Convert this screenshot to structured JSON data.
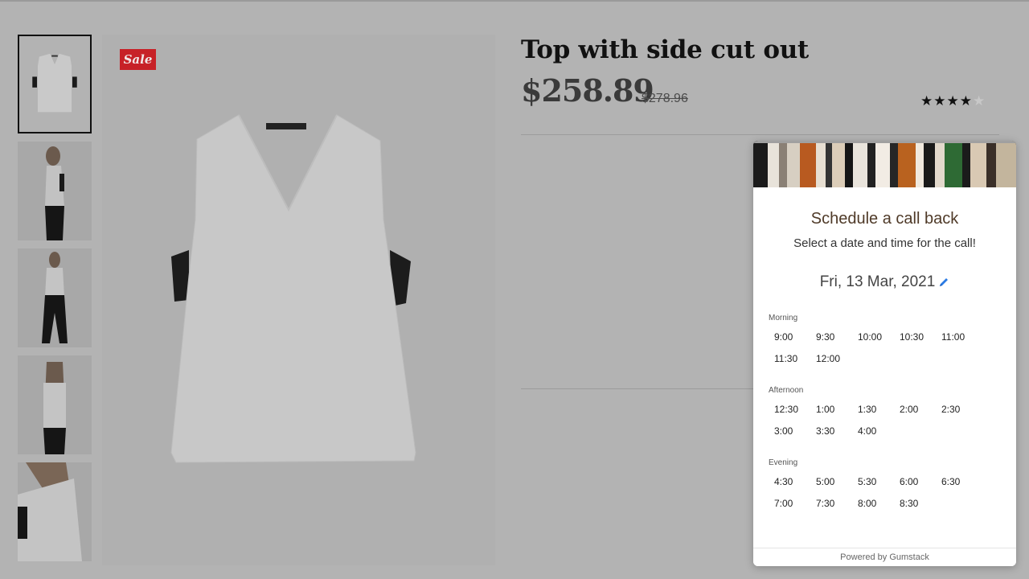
{
  "product": {
    "title": "Top with side cut out",
    "price": "$258.89",
    "old_price": "$278.96",
    "sale_label": "Sale",
    "rating": 4,
    "rating_max": 5
  },
  "thumbnails": [
    {
      "name": "thumbnail-garment-front",
      "selected": true
    },
    {
      "name": "thumbnail-model-side"
    },
    {
      "name": "thumbnail-model-front"
    },
    {
      "name": "thumbnail-model-back"
    },
    {
      "name": "thumbnail-model-closeup"
    }
  ],
  "widget": {
    "title": "Schedule a call back",
    "subtitle": "Select a date and time for the call!",
    "date": "Fri, 13 Mar, 2021",
    "groups": [
      {
        "label": "Morning",
        "slots": [
          "9:00",
          "9:30",
          "10:00",
          "10:30",
          "11:00",
          "11:30",
          "12:00"
        ]
      },
      {
        "label": "Afternoon",
        "slots": [
          "12:30",
          "1:00",
          "1:30",
          "2:00",
          "2:30",
          "3:00",
          "3:30",
          "4:00"
        ]
      },
      {
        "label": "Evening",
        "slots": [
          "4:30",
          "5:00",
          "5:30",
          "6:00",
          "6:30",
          "7:00",
          "7:30",
          "8:00",
          "8:30"
        ]
      }
    ],
    "footer": "Powered by Gumstack"
  },
  "colors": {
    "sale_badge": "#c72127",
    "widget_title": "#4f3a28",
    "edit_icon": "#2a7be4",
    "page_overlay": "#b3b3b3"
  }
}
